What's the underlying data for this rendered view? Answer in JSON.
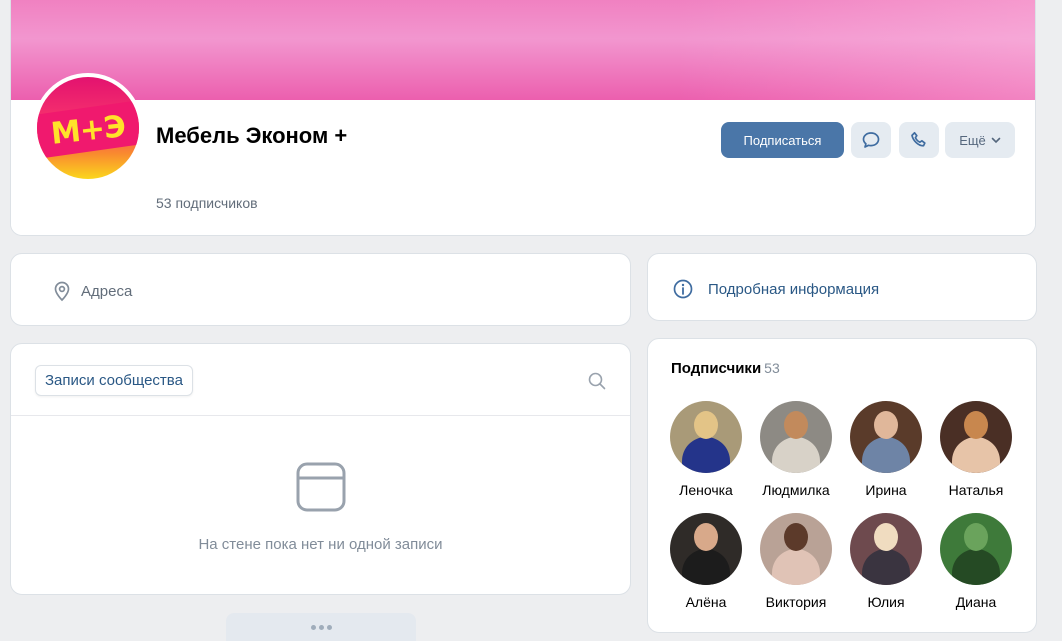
{
  "header": {
    "title": "Мебель Эконом +",
    "subscribers_text": "53 подписчиков",
    "avatar_text": "М+Э",
    "subscribe_label": "Подписаться",
    "more_label": "Ещё"
  },
  "address": {
    "label": "Адреса"
  },
  "wall": {
    "tab_label": "Записи сообщества",
    "empty_text": "На стене пока нет ни одной записи"
  },
  "info": {
    "label": "Подробная информация"
  },
  "followers": {
    "title": "Подписчики",
    "count": "53",
    "items": [
      {
        "name": "Леночка",
        "bg": "#a99a78",
        "head": "#e3c487",
        "body": "#24348a"
      },
      {
        "name": "Людмилка",
        "bg": "#8d8a84",
        "head": "#c28a5c",
        "body": "#d8d2c8"
      },
      {
        "name": "Ирина",
        "bg": "#5a3b2a",
        "head": "#e0b79a",
        "body": "#6e84a6"
      },
      {
        "name": "Наталья",
        "bg": "#4a2f25",
        "head": "#c8874e",
        "body": "#e7c4a8"
      },
      {
        "name": "Алёна",
        "bg": "#2f2b28",
        "head": "#d8a98a",
        "body": "#1c1c1c"
      },
      {
        "name": "Виктория",
        "bg": "#b9a296",
        "head": "#5c3a2a",
        "body": "#e0c3b6"
      },
      {
        "name": "Юлия",
        "bg": "#6e4a4e",
        "head": "#f0dcc0",
        "body": "#3a3440"
      },
      {
        "name": "Диана",
        "bg": "#3e7a3a",
        "head": "#6aa35c",
        "body": "#254a24"
      }
    ]
  },
  "colors": {
    "accent": "#4a76a8",
    "link": "#2a5885",
    "cover": "#f07bbd"
  }
}
